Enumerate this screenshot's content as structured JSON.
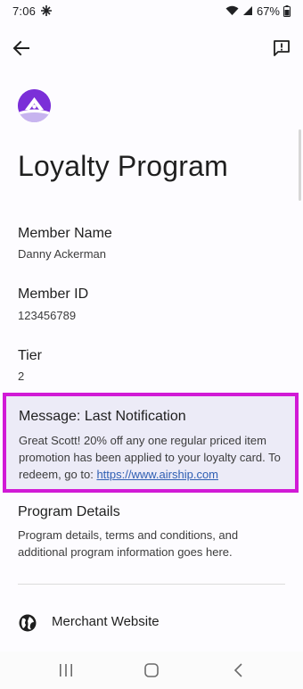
{
  "status_bar": {
    "time": "7:06",
    "battery": "67%",
    "icons": [
      "grid-icon",
      "wifi-icon",
      "signal-icon",
      "battery-icon"
    ]
  },
  "app_bar": {
    "back_icon": "arrow-back-icon",
    "feedback_icon": "feedback-icon"
  },
  "logo": {
    "icon": "house-logo-icon",
    "color": "#7b2fd8"
  },
  "page": {
    "title": "Loyalty Program"
  },
  "fields": [
    {
      "label": "Member Name",
      "value": "Danny Ackerman"
    },
    {
      "label": "Member ID",
      "value": "123456789"
    },
    {
      "label": "Tier",
      "value": "2"
    }
  ],
  "message": {
    "title": "Message: Last Notification",
    "body": "Great Scott! 20% off any one regular priced item promotion has been applied to your loyalty card. To redeem, go to: ",
    "link": "https://www.airship.com",
    "highlight_color": "#d11ad6"
  },
  "program_details": {
    "title": "Program Details",
    "body": "Program details, terms and conditions, and additional program information goes here."
  },
  "merchant": {
    "icon": "globe-icon",
    "label": "Merchant Website"
  },
  "nav_bar": {
    "icons": [
      "recents-icon",
      "home-icon",
      "back-icon"
    ]
  }
}
